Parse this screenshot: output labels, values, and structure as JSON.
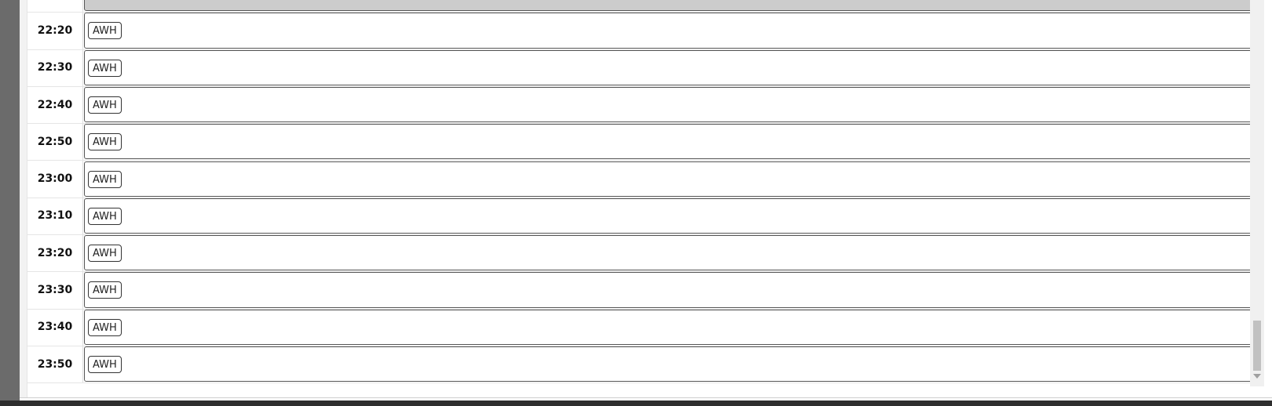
{
  "schedule": {
    "rows": [
      {
        "time": "",
        "tag": "",
        "filled": true
      },
      {
        "time": "22:20",
        "tag": "AWH",
        "filled": false
      },
      {
        "time": "22:30",
        "tag": "AWH",
        "filled": false
      },
      {
        "time": "22:40",
        "tag": "AWH",
        "filled": false
      },
      {
        "time": "22:50",
        "tag": "AWH",
        "filled": false
      },
      {
        "time": "23:00",
        "tag": "AWH",
        "filled": false
      },
      {
        "time": "23:10",
        "tag": "AWH",
        "filled": false
      },
      {
        "time": "23:20",
        "tag": "AWH",
        "filled": false
      },
      {
        "time": "23:30",
        "tag": "AWH",
        "filled": false
      },
      {
        "time": "23:40",
        "tag": "AWH",
        "filled": false
      },
      {
        "time": "23:50",
        "tag": "AWH",
        "filled": false
      }
    ],
    "expand_icon": "expand-arrow-icon"
  },
  "colors": {
    "filled_slot": "#cccccc",
    "sidebar": "#6b6b6b"
  }
}
